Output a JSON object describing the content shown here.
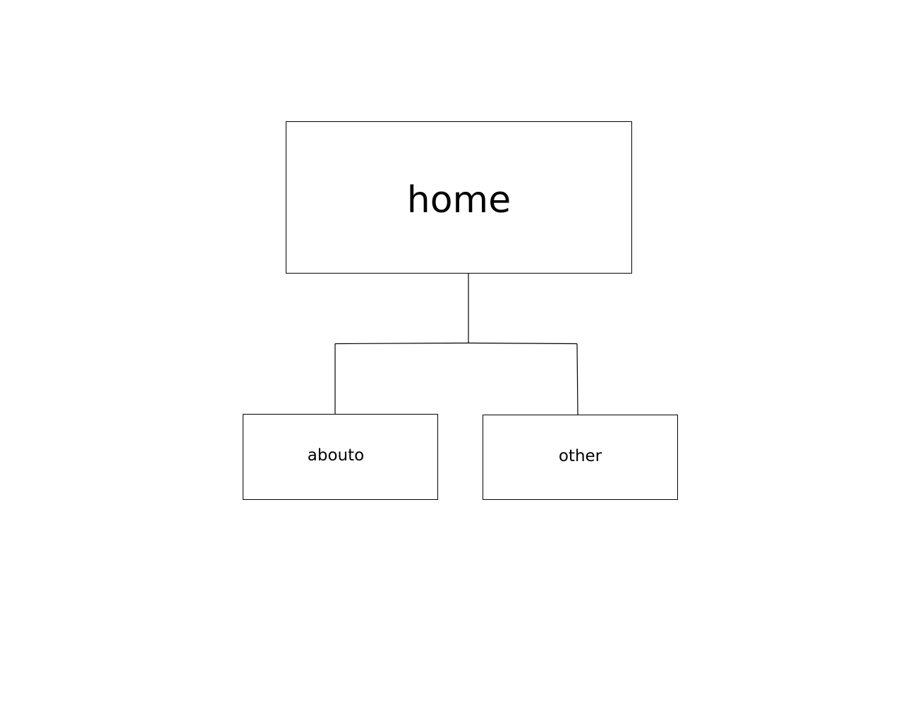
{
  "diagram": {
    "root": {
      "label": "home"
    },
    "children": [
      {
        "label": "abouto"
      },
      {
        "label": "other"
      }
    ]
  }
}
